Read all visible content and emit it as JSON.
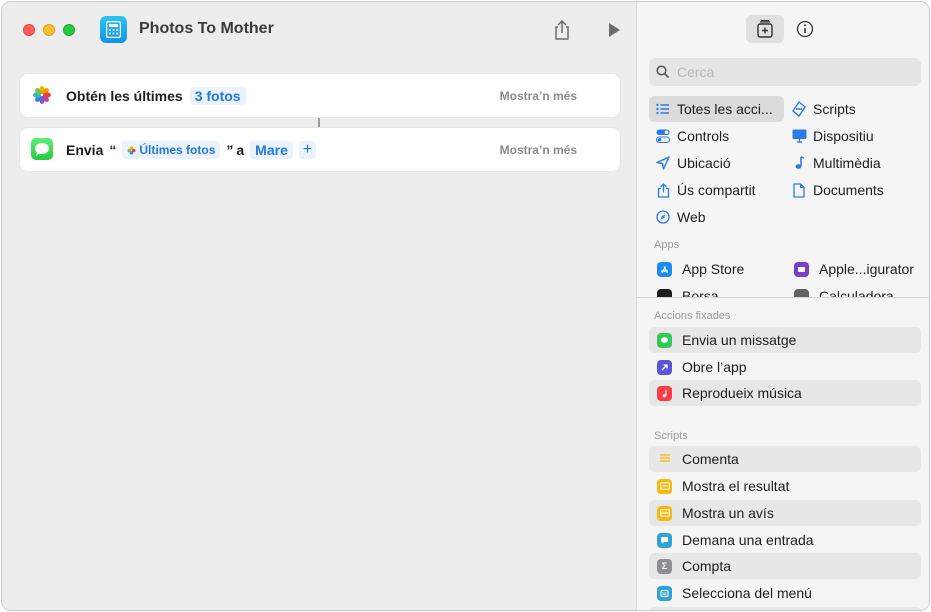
{
  "window": {
    "title": "Photos To Mother"
  },
  "workflow": {
    "actions": [
      {
        "verb": "Obtén les últimes",
        "param": "3 fotos",
        "more": "Mostra’n més"
      },
      {
        "verb": "Envia",
        "open_quote": "“",
        "variable": "Últimes fotos",
        "close_quote": "”",
        "joiner": "a",
        "recipient": "Mare",
        "add": "+",
        "more": "Mostra’n més"
      }
    ]
  },
  "sidebar": {
    "search": {
      "placeholder": "Cerca",
      "value": ""
    },
    "categories": [
      {
        "label": "Totes les acci...",
        "icon": "list-icon",
        "selected": true
      },
      {
        "label": "Scripts",
        "icon": "scripts-icon"
      },
      {
        "label": "Controls",
        "icon": "toggle-icon"
      },
      {
        "label": "Dispositiu",
        "icon": "monitor-icon"
      },
      {
        "label": "Ubicació",
        "icon": "location-arrow-icon"
      },
      {
        "label": "Multimèdia",
        "icon": "music-note-icon"
      },
      {
        "label": "Ús compartit",
        "icon": "share-icon"
      },
      {
        "label": "Documents",
        "icon": "document-icon"
      },
      {
        "label": "Web",
        "icon": "compass-icon"
      }
    ],
    "apps_label": "Apps",
    "apps": [
      {
        "label": "App Store",
        "color": "#1a8cf5"
      },
      {
        "label": "Apple...igurator",
        "color": "#7b3fc4"
      },
      {
        "label": "Borsa",
        "color": "#1c1c1e"
      },
      {
        "label": "Calculadora",
        "color": "#636366"
      }
    ],
    "pinned_label": "Accions fixades",
    "pinned": [
      {
        "label": "Envia un missatge",
        "color": "#34c759"
      },
      {
        "label": "Obre l’app",
        "color": "#5856d6"
      },
      {
        "label": "Reprodueix música",
        "color": "#fc3c44"
      }
    ],
    "scripts_label": "Scripts",
    "scripts": [
      {
        "label": "Comenta",
        "color": "#f7c948"
      },
      {
        "label": "Mostra el resultat",
        "color": "#f5b914"
      },
      {
        "label": "Mostra un avís",
        "color": "#f5b914"
      },
      {
        "label": "Demana una entrada",
        "color": "#2ba3d6"
      },
      {
        "label": "Compta",
        "color": "#8e8e93"
      },
      {
        "label": "Selecciona del menú",
        "color": "#2ba3d6"
      }
    ]
  }
}
